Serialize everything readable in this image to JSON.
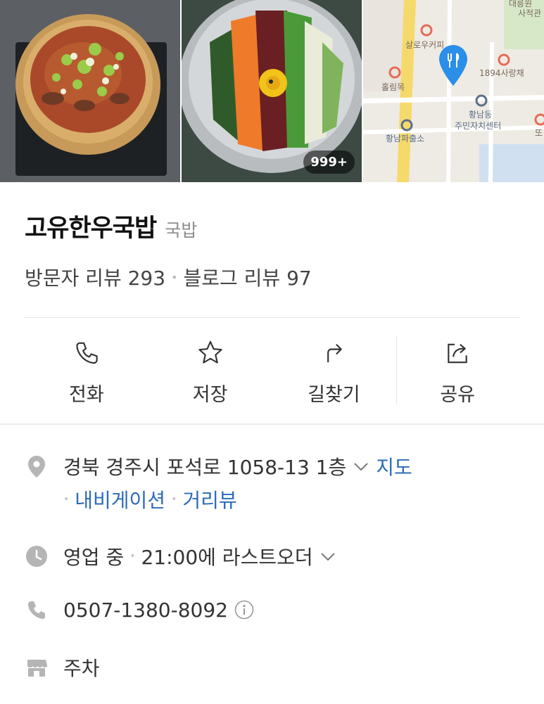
{
  "photos": {
    "count_badge": "999+",
    "map_labels": [
      "대릉원",
      "사적관",
      "살로우커피",
      "1894사랑채",
      "홀림목",
      "황남동",
      "주민자치센터",
      "황남파출소",
      "또"
    ]
  },
  "place": {
    "name": "고유한우국밥",
    "category": "국밥",
    "visitor_reviews": "방문자 리뷰 293",
    "blog_reviews": "블로그 리뷰 97"
  },
  "actions": [
    {
      "label": "전화",
      "icon": "phone-icon"
    },
    {
      "label": "저장",
      "icon": "star-icon"
    },
    {
      "label": "길찾기",
      "icon": "directions-icon"
    },
    {
      "label": "공유",
      "icon": "share-icon"
    }
  ],
  "info": {
    "address": "경북 경주시 포석로 1058-13 1층",
    "map_link": "지도",
    "navigation_link": "내비게이션",
    "street_view_link": "거리뷰",
    "hours_status": "영업 중",
    "hours_detail": "21:00에 라스트오더",
    "phone": "0507-1380-8092",
    "parking": "주차"
  },
  "colors": {
    "link": "#2c6bb9",
    "map_pin": "#2b8ee8",
    "icon_gray": "#b5b5b5"
  }
}
